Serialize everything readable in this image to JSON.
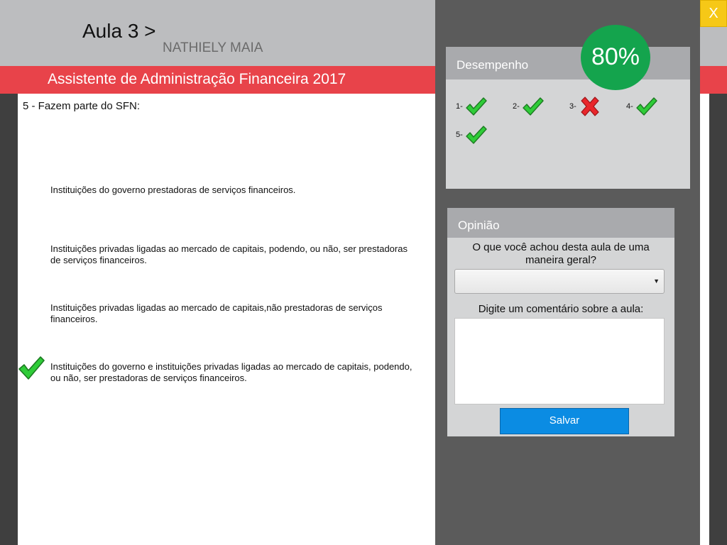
{
  "header": {
    "lesson_title": "Aula 3 >",
    "student_name": "NATHIELY MAIA",
    "course_title": "Assistente de Administração Financeira 2017"
  },
  "question": {
    "text": "5 - Fazem parte do SFN:",
    "options": [
      {
        "text": "Instituições do governo prestadoras de serviços financeiros.",
        "marked_correct": false
      },
      {
        "text": "Instituições privadas ligadas ao mercado de capitais, podendo, ou não, ser prestadoras de serviços financeiros.",
        "marked_correct": false
      },
      {
        "text": "Instituições privadas ligadas ao mercado de capitais,não prestadoras de serviços financeiros.",
        "marked_correct": false
      },
      {
        "text": "Instituições do governo e instituições privadas ligadas ao mercado de capitais, podendo, ou não, ser prestadoras de serviços financeiros.",
        "marked_correct": true
      }
    ]
  },
  "close_button": {
    "label": "X"
  },
  "performance": {
    "title": "Desempenho",
    "score": "80%",
    "items": [
      {
        "label": "1-",
        "result": "correct",
        "icon": "check-icon"
      },
      {
        "label": "2-",
        "result": "correct",
        "icon": "check-icon"
      },
      {
        "label": "3-",
        "result": "wrong",
        "icon": "cross-icon"
      },
      {
        "label": "4-",
        "result": "correct",
        "icon": "check-icon"
      },
      {
        "label": "5-",
        "result": "correct",
        "icon": "check-icon"
      }
    ]
  },
  "opinion": {
    "title": "Opinião",
    "question": "O que você achou desta aula de uma maneira geral?",
    "rating_value": "",
    "comment_label": "Digite um comentário sobre a aula:",
    "comment_value": "",
    "save_label": "Salvar"
  },
  "colors": {
    "red_band": "#e8434a",
    "score_green": "#14a44d",
    "save_blue": "#0b8ce3",
    "close_yellow": "#f6c817",
    "check_green": "#2fcc38",
    "cross_red": "#e8262b"
  }
}
